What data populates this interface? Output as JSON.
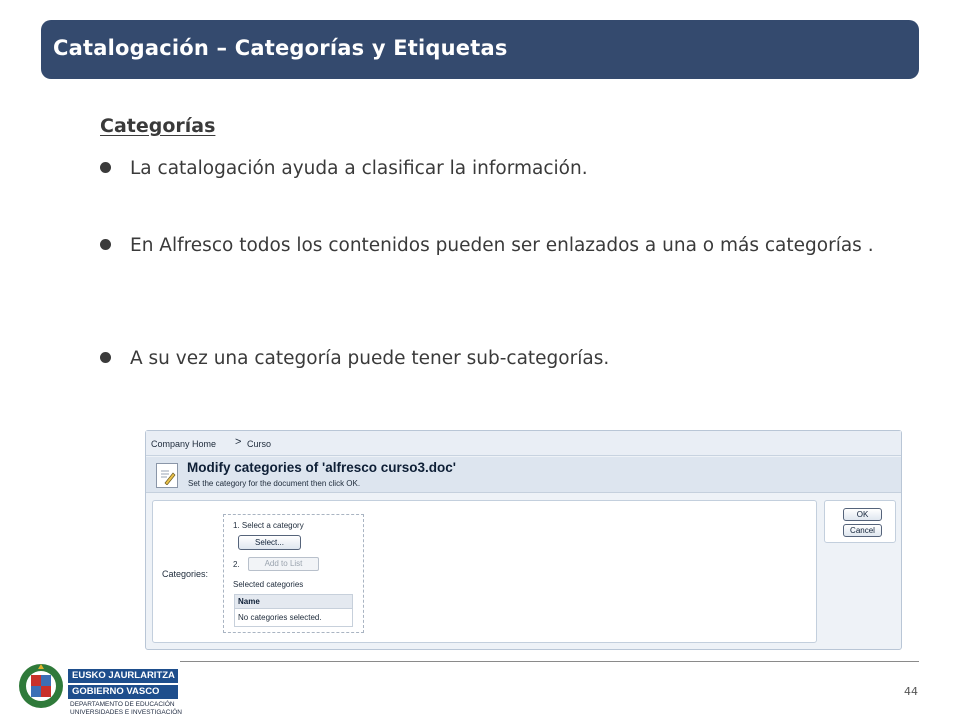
{
  "slide": {
    "title": "Catalogación – Categorías y Etiquetas",
    "section_heading": "Categorías",
    "bullets": [
      "La catalogación ayuda a clasificar la información.",
      "En Alfresco todos los contenidos pueden ser enlazados a una o más categorías .",
      "A su vez una categoría puede tener sub-categorías."
    ],
    "page_number": "44",
    "colors": {
      "title_bar": "#344a6e",
      "text": "#3a3a3a",
      "logo_blue": "#1e4e8c"
    }
  },
  "alfresco": {
    "breadcrumb": {
      "home": "Company Home",
      "separator": ">",
      "current": "Curso"
    },
    "header": {
      "title": "Modify categories of 'alfresco curso3.doc'",
      "subtitle": "Set the category for the document then click OK.",
      "icon": "edit-document-icon"
    },
    "form": {
      "label": "Categories:",
      "step1": "1. Select a category",
      "select_button": "Select...",
      "step2": "2.",
      "add_button": "Add to List",
      "selected_label": "Selected categories",
      "table_header": "Name",
      "table_empty": "No categories selected."
    },
    "buttons": {
      "ok": "OK",
      "cancel": "Cancel"
    }
  },
  "logo": {
    "line1": "EUSKO JAURLARITZA",
    "line2": "GOBIERNO VASCO",
    "dept1": "DEPARTAMENTO DE EDUCACIÓN",
    "dept2": "UNIVERSIDADES E INVESTIGACIÓN"
  }
}
